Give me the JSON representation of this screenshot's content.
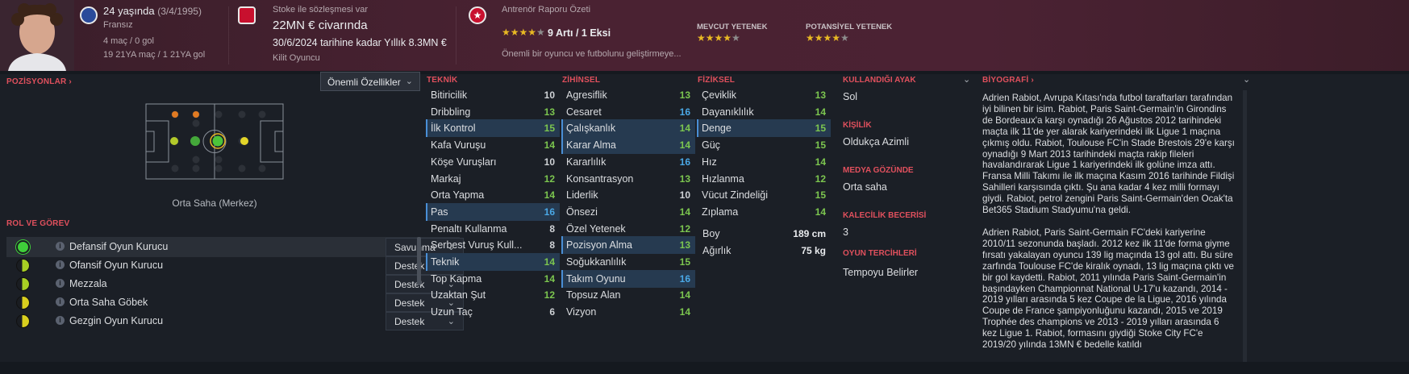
{
  "header": {
    "age_line": "24 yaşında",
    "dob": "(3/4/1995)",
    "nationality": "Fransız",
    "caps": "4 maç / 0 gol",
    "youth": "19 21YA maç / 1 21YA gol",
    "contract_label": "Stoke ile sözleşmesi var",
    "value": "22MN € civarında",
    "contract_until": "30/6/2024 tarihine kadar Yıllık 8.3MN €",
    "squad_status": "Kilit Oyuncu",
    "report_title": "Antrenör Raporu Özeti",
    "report_summary": "9 Artı / 1 Eksi",
    "report_note": "Önemli bir oyuncu ve futbolunu geliştirmeye...",
    "current_ability_label": "MEVCUT YETENEK",
    "potential_ability_label": "POTANSİYEL YETENEK",
    "report_stars": 4,
    "current_stars": 4,
    "potential_stars": 4
  },
  "positions": {
    "title": "POZİSYONLAR",
    "dropdown": "Önemli Özellikler",
    "position_name": "Orta Saha (Merkez)"
  },
  "roles": {
    "title": "ROL VE GÖREV",
    "items": [
      {
        "name": "Defansif Oyun Kurucu",
        "duty": "Savunma"
      },
      {
        "name": "Ofansif Oyun Kurucu",
        "duty": "Destek"
      },
      {
        "name": "Mezzala",
        "duty": "Destek"
      },
      {
        "name": "Orta Saha Göbek",
        "duty": "Destek"
      },
      {
        "name": "Gezgin Oyun Kurucu",
        "duty": "Destek"
      }
    ]
  },
  "technical": {
    "title": "TEKNİK",
    "attrs": [
      {
        "name": "Bitiricilik",
        "value": "10"
      },
      {
        "name": "Dribbling",
        "value": "13"
      },
      {
        "name": "İlk Kontrol",
        "value": "15"
      },
      {
        "name": "Kafa Vuruşu",
        "value": "14"
      },
      {
        "name": "Köşe Vuruşları",
        "value": "10"
      },
      {
        "name": "Markaj",
        "value": "12"
      },
      {
        "name": "Orta Yapma",
        "value": "14"
      },
      {
        "name": "Pas",
        "value": "16"
      },
      {
        "name": "Penaltı Kullanma",
        "value": "8"
      },
      {
        "name": "Serbest Vuruş Kull...",
        "value": "8"
      },
      {
        "name": "Teknik",
        "value": "14"
      },
      {
        "name": "Top Kapma",
        "value": "14"
      },
      {
        "name": "Uzaktan Şut",
        "value": "12"
      },
      {
        "name": "Uzun Taç",
        "value": "6"
      }
    ]
  },
  "mental": {
    "title": "ZİHİNSEL",
    "attrs": [
      {
        "name": "Agresiflik",
        "value": "13"
      },
      {
        "name": "Cesaret",
        "value": "16"
      },
      {
        "name": "Çalışkanlık",
        "value": "14"
      },
      {
        "name": "Karar Alma",
        "value": "14"
      },
      {
        "name": "Kararlılık",
        "value": "16"
      },
      {
        "name": "Konsantrasyon",
        "value": "13"
      },
      {
        "name": "Liderlik",
        "value": "10"
      },
      {
        "name": "Önsezi",
        "value": "14"
      },
      {
        "name": "Özel Yetenek",
        "value": "12"
      },
      {
        "name": "Pozisyon Alma",
        "value": "13"
      },
      {
        "name": "Soğukkanlılık",
        "value": "15"
      },
      {
        "name": "Takım Oyunu",
        "value": "16"
      },
      {
        "name": "Topsuz Alan",
        "value": "14"
      },
      {
        "name": "Vizyon",
        "value": "14"
      }
    ]
  },
  "physical": {
    "title": "FİZİKSEL",
    "attrs": [
      {
        "name": "Çeviklik",
        "value": "13"
      },
      {
        "name": "Dayanıklılık",
        "value": "14"
      },
      {
        "name": "Denge",
        "value": "15"
      },
      {
        "name": "Güç",
        "value": "15"
      },
      {
        "name": "Hız",
        "value": "14"
      },
      {
        "name": "Hızlanma",
        "value": "12"
      },
      {
        "name": "Vücut Zindeliği",
        "value": "15"
      },
      {
        "name": "Zıplama",
        "value": "14"
      }
    ],
    "height_label": "Boy",
    "height": "189 cm",
    "weight_label": "Ağırlık",
    "weight": "75 kg"
  },
  "info": {
    "foot_label": "KULLANDIĞI AYAK",
    "foot": "Sol",
    "personality_label": "KİŞİLİK",
    "personality": "Oldukça Azimli",
    "media_label": "MEDYA GÖZÜNDE",
    "media": "Orta saha",
    "gk_label": "KALECİLİK BECERİSİ",
    "gk": "3",
    "prefs_label": "OYUN TERCİHLERİ",
    "prefs": "Tempoyu Belirler"
  },
  "bio": {
    "title": "BİYOGRAFİ",
    "p1": "Adrien Rabiot, Avrupa Kıtası'nda futbol taraftarları tarafından iyi bilinen bir isim. Rabiot, Paris Saint-Germain'in Girondins de Bordeaux'a karşı oynadığı 26 Ağustos 2012 tarihindeki maçta ilk 11'de yer alarak kariyerindeki ilk Ligue 1 maçına çıkmış oldu. Rabiot, Toulouse FC'in Stade Brestois 29'e karşı oynadığı 9 Mart 2013 tarihindeki maçta rakip fileleri havalandırarak Ligue 1 kariyerindeki ilk golüne imza attı. Fransa Milli Takımı ile ilk maçına Kasım 2016 tarihinde Fildişi Sahilleri karşısında çıktı. Şu ana kadar 4 kez milli formayı giydi. Rabiot, petrol zengini Paris Saint-Germain'den Ocak'ta Bet365 Stadium Stadyumu'na geldi.",
    "p2": "Adrien Rabiot, Paris Saint-Germain FC'deki kariyerine 2010/11 sezonunda başladı. 2012 kez ilk 11'de forma giyme fırsatı yakalayan oyuncu 139 lig maçında 13 gol attı. Bu süre zarfında Toulouse FC'de kiralık oynadı, 13 lig maçına çıktı ve bir gol kaydetti. Rabiot, 2011 yılında Paris Saint-Germain'in başındayken Championnat National U-17'u kazandı, 2014 - 2019 yılları arasında 5 kez Coupe de la Ligue, 2016 yılında Coupe de France şampiyonluğunu kazandı, 2015 ve 2019 Trophée des champions ve 2013 - 2019 yılları arasında 6 kez Ligue 1. Rabiot, formasını giydiği Stoke City FC'e 2019/20 yılında 13MN € bedelle katıldı"
  }
}
